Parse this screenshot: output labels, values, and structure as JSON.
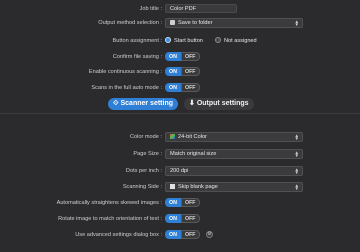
{
  "job_title": {
    "label": "Job title :",
    "value": "Color PDF"
  },
  "output_method": {
    "label": "Output method selection :",
    "value": "Save to folder",
    "icon": "folder-icon"
  },
  "button_assignment": {
    "label": "Button assignment :",
    "option1": "Start button",
    "option2": "Not assigned",
    "selected": "Start button"
  },
  "confirm_file_saving": {
    "label": "Confirm file saving :",
    "on": "ON",
    "off": "OFF",
    "state": "ON"
  },
  "continuous_scanning": {
    "label": "Enable continuous scanning :",
    "on": "ON",
    "off": "OFF",
    "state": "ON"
  },
  "full_auto_mode": {
    "label": "Scans in the full auto mode :",
    "on": "ON",
    "off": "OFF",
    "state": "ON"
  },
  "tabs": {
    "scanner_settings": "Scanner setting",
    "output_settings": "Output settings",
    "active": "Scanner setting"
  },
  "color_mode": {
    "label": "Color mode :",
    "value": "24-bit Color",
    "icon": "color-swatch-icon"
  },
  "page_size": {
    "label": "Page Size :",
    "value": "Match original size"
  },
  "dots_per_inch": {
    "label": "Dots per inch :",
    "value": "200 dpi"
  },
  "scanning_side": {
    "label": "Scanning Side :",
    "value": "Skip blank page",
    "icon": "page-icon"
  },
  "straighten_skewed": {
    "label": "Automatically straightens skewed images :",
    "on": "ON",
    "off": "OFF",
    "state": "ON"
  },
  "rotate_image": {
    "label": "Rotate image to match orientation of text :",
    "on": "ON",
    "off": "OFF",
    "state": "ON"
  },
  "advanced_dialog": {
    "label": "Use advanced settings dialog box :",
    "on": "ON",
    "off": "OFF",
    "state": "ON"
  },
  "colors": {
    "accent": "#2f7fd6",
    "background": "#2b2b2d"
  }
}
